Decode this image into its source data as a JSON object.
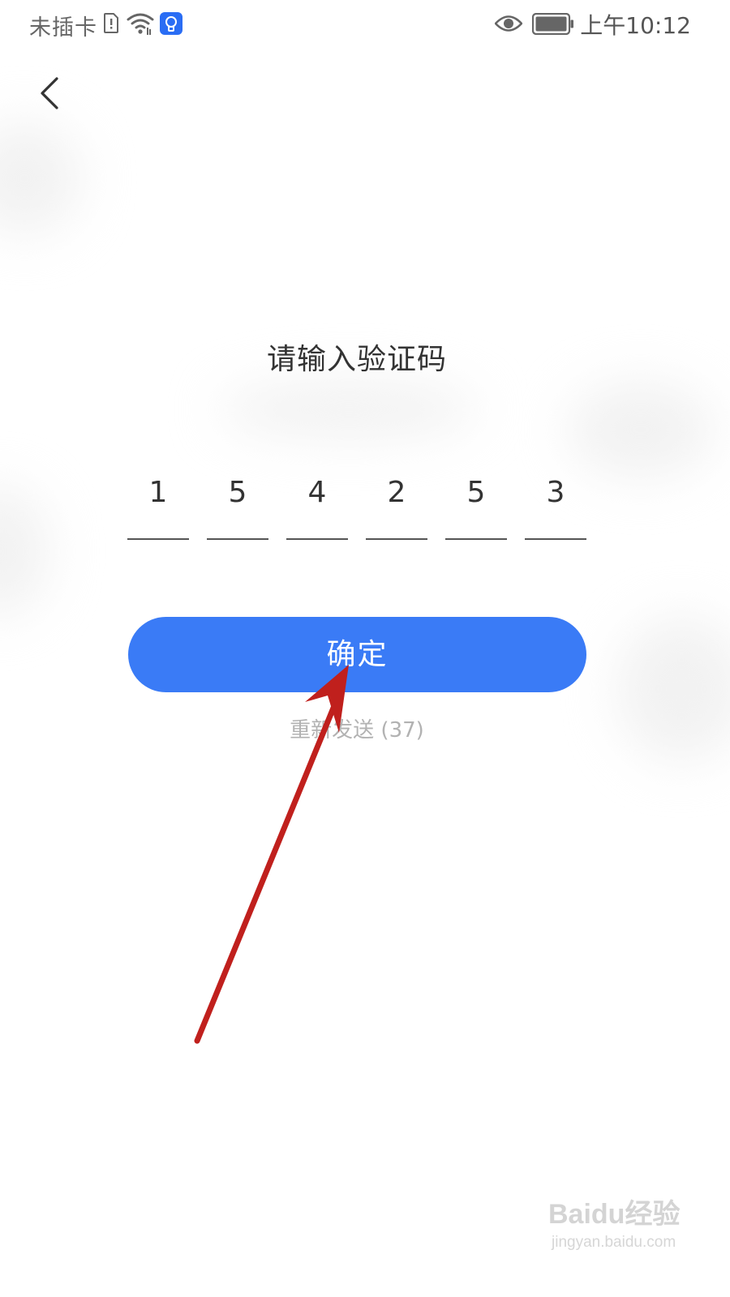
{
  "status_bar": {
    "carrier": "未插卡",
    "time": "上午10:12",
    "icons": [
      "sim-icon",
      "wifi-icon",
      "app-badge-icon",
      "eye-icon",
      "battery-icon"
    ]
  },
  "nav": {
    "back_icon": "chevron-left-icon"
  },
  "verification": {
    "title": "请输入验证码",
    "digits": [
      "1",
      "5",
      "4",
      "2",
      "5",
      "3"
    ],
    "confirm_label": "确定",
    "resend_label": "重新发送 (37)"
  },
  "annotation": {
    "arrow_color": "#c0201d"
  },
  "watermark": {
    "main": "Baidu经验",
    "sub": "jingyan.baidu.com"
  },
  "colors": {
    "primary_button": "#3a7bf6",
    "text": "#333333",
    "muted_text": "#b2b2b2"
  }
}
